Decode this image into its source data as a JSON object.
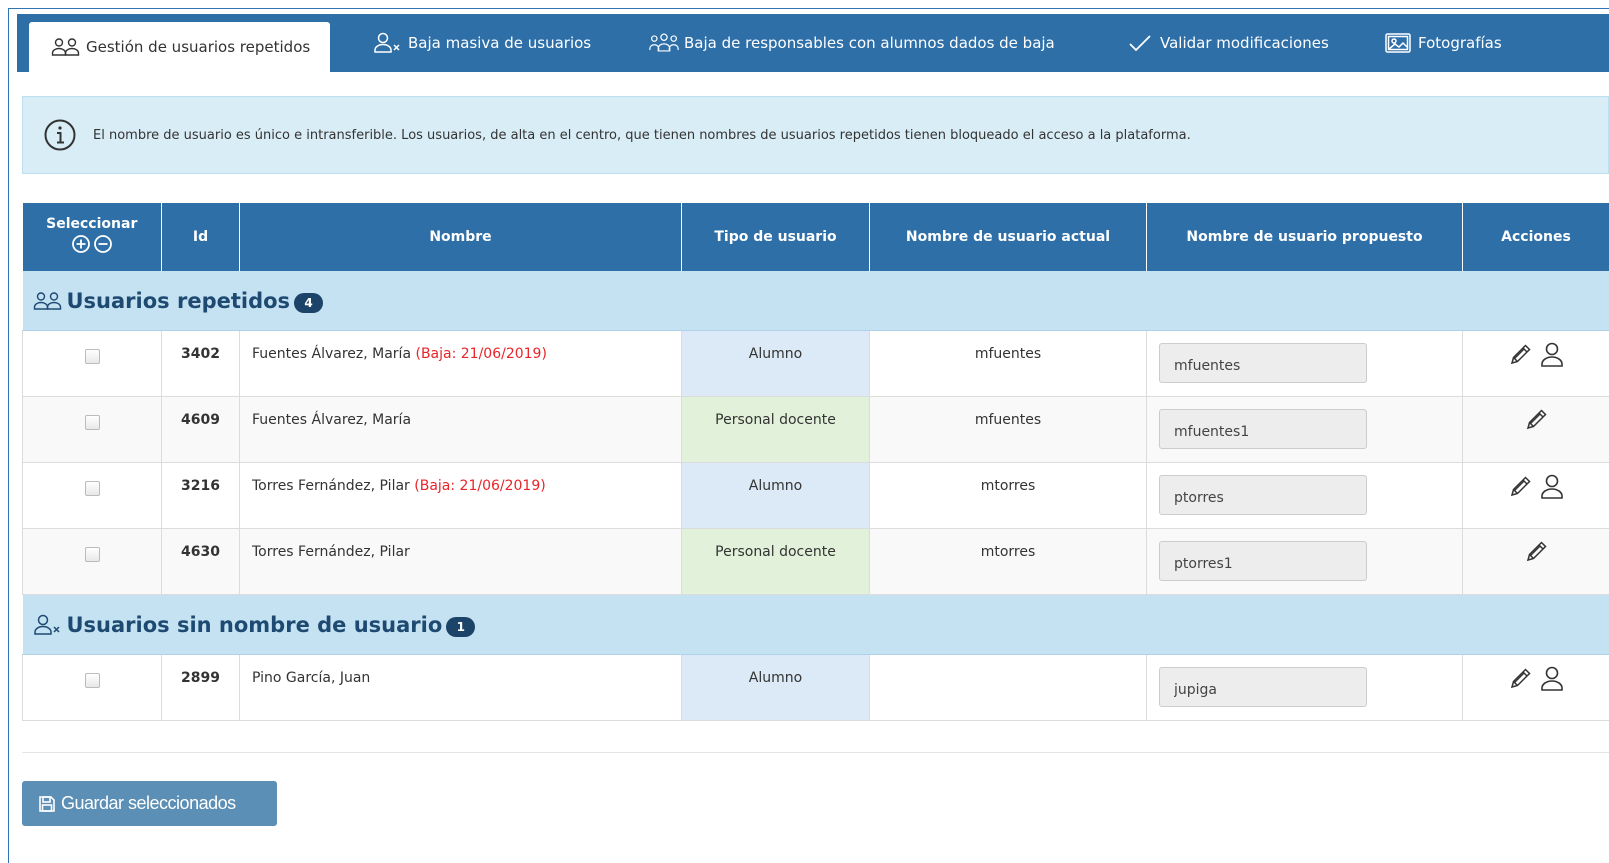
{
  "tabs": [
    {
      "label": "Gestión de usuarios repetidos",
      "icon": "users-icon",
      "active": true
    },
    {
      "label": "Baja masiva de usuarios",
      "icon": "user-remove-icon",
      "active": false
    },
    {
      "label": "Baja de responsables con alumnos dados de baja",
      "icon": "group-icon",
      "active": false
    },
    {
      "label": "Validar modificaciones",
      "icon": "check-icon",
      "active": false
    },
    {
      "label": "Fotografías",
      "icon": "image-icon",
      "active": false
    }
  ],
  "alert": {
    "text": "El nombre de usuario es único e intransferible. Los usuarios, de alta en el centro, que tienen nombres de usuarios repetidos tienen bloqueado el acceso a la plataforma."
  },
  "table": {
    "headers": {
      "select": "Seleccionar",
      "id": "Id",
      "name": "Nombre",
      "type": "Tipo de usuario",
      "current": "Nombre de usuario actual",
      "proposed": "Nombre de usuario propuesto",
      "actions": "Acciones"
    },
    "groups": [
      {
        "title": "Usuarios repetidos",
        "count": "4",
        "rows": [
          {
            "id": "3402",
            "name": "Fuentes Álvarez, María",
            "baja": "(Baja: 21/06/2019)",
            "type": "Alumno",
            "current": "mfuentes",
            "proposed": "mfuentes"
          },
          {
            "id": "4609",
            "name": "Fuentes Álvarez, María",
            "baja": "",
            "type": "Personal docente",
            "current": "mfuentes",
            "proposed": "mfuentes1"
          },
          {
            "id": "3216",
            "name": "Torres Fernández, Pilar",
            "baja": "(Baja: 21/06/2019)",
            "type": "Alumno",
            "current": "mtorres",
            "proposed": "ptorres"
          },
          {
            "id": "4630",
            "name": "Torres Fernández, Pilar",
            "baja": "",
            "type": "Personal docente",
            "current": "mtorres",
            "proposed": "ptorres1"
          }
        ]
      },
      {
        "title": "Usuarios sin nombre de usuario",
        "count": "1",
        "rows": [
          {
            "id": "2899",
            "name": "Pino García, Juan",
            "baja": "",
            "type": "Alumno",
            "current": "",
            "proposed": "jupiga"
          }
        ]
      }
    ]
  },
  "save_button": {
    "label": "Guardar seleccionados"
  },
  "colors": {
    "primary": "#2e6fa8",
    "alert_bg": "#d9edf7",
    "group_bg": "#c5e2f3",
    "baja_red": "#e8252a",
    "type_blue": "#dbeaf6",
    "type_green": "#e2f1da"
  }
}
